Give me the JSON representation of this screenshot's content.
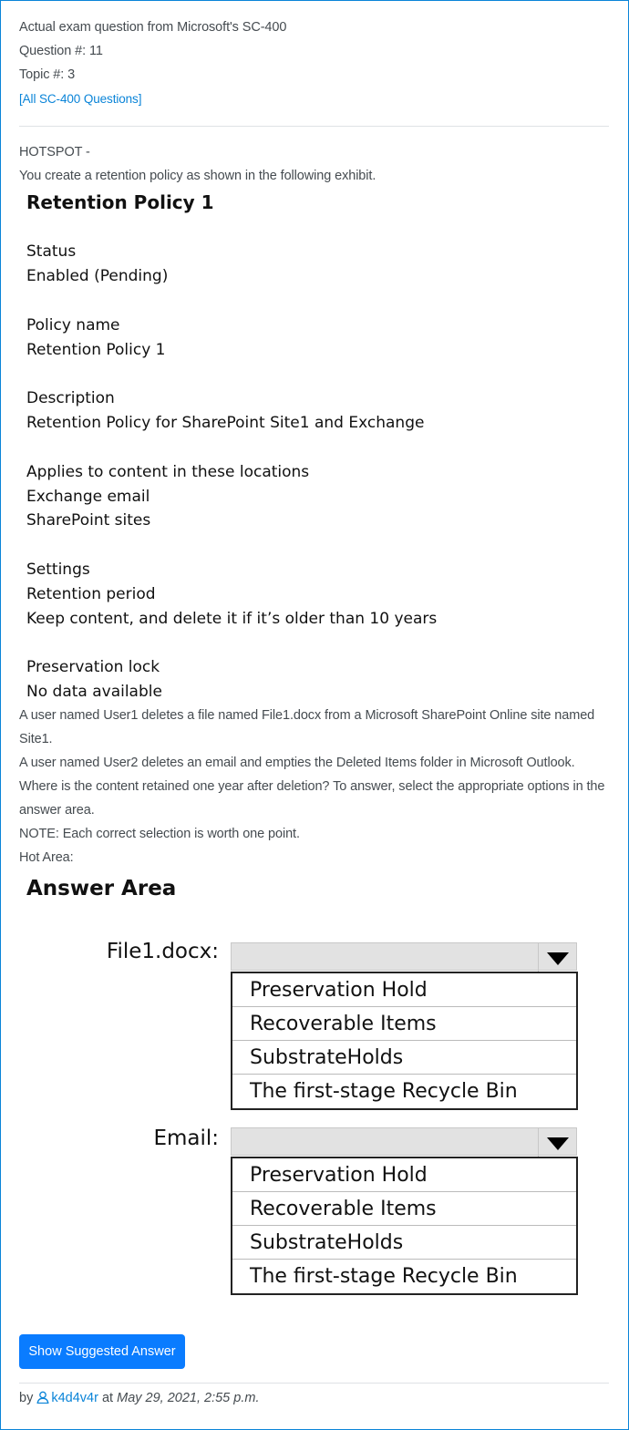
{
  "header": {
    "line1": "Actual exam question from Microsoft's SC-400",
    "question_no": "Question #: 11",
    "topic_no": "Topic #: 3",
    "all_questions_link": "[All SC-400 Questions]"
  },
  "question": {
    "type": "HOTSPOT -",
    "intro": "You create a retention policy as shown in the following exhibit.",
    "body_1a": "A user named User1 deletes a file named File1.docx from a Microsoft SharePoint Online site named",
    "body_1b": "Site1.",
    "body_2": "A user named User2 deletes an email and empties the Deleted Items folder in Microsoft Outlook.",
    "body_3a": "Where is the content retained one year after deletion? To answer, select the appropriate options in the",
    "body_3b": "answer area.",
    "note": "NOTE: Each correct selection is worth one point.",
    "hot_area": "Hot Area:"
  },
  "exhibit": {
    "title": "Retention Policy 1",
    "status_label": "Status",
    "status_value": "Enabled (Pending)",
    "name_label": "Policy name",
    "name_value": "Retention Policy 1",
    "desc_label": "Description",
    "desc_value": "Retention Policy for SharePoint Site1 and Exchange",
    "locations_label": "Applies to content in these locations",
    "location_1": "Exchange email",
    "location_2": "SharePoint sites",
    "settings_label": "Settings",
    "period_label": "Retention period",
    "period_value": "Keep content, and delete it if it’s older than 10 years",
    "lock_label": "Preservation lock",
    "lock_value": "No data available"
  },
  "answer_area": {
    "title": "Answer Area",
    "file_label": "File1.docx:",
    "email_label": "Email:",
    "file_options": [
      "Preservation Hold",
      "Recoverable Items",
      "SubstrateHolds",
      "The first-stage Recycle Bin"
    ],
    "email_options": [
      "Preservation Hold",
      "Recoverable Items",
      "SubstrateHolds",
      "The first-stage Recycle Bin"
    ]
  },
  "button": {
    "label": "Show Suggested Answer"
  },
  "footer": {
    "by": "by",
    "author": "k4d4v4r",
    "at": "at",
    "date": "May 29, 2021, 2:55 p.m."
  },
  "icons": {
    "dropdown": "triangle-down-icon",
    "user": "user-icon"
  },
  "colors": {
    "accent": "#0a84d8",
    "button": "#0a7cff"
  }
}
